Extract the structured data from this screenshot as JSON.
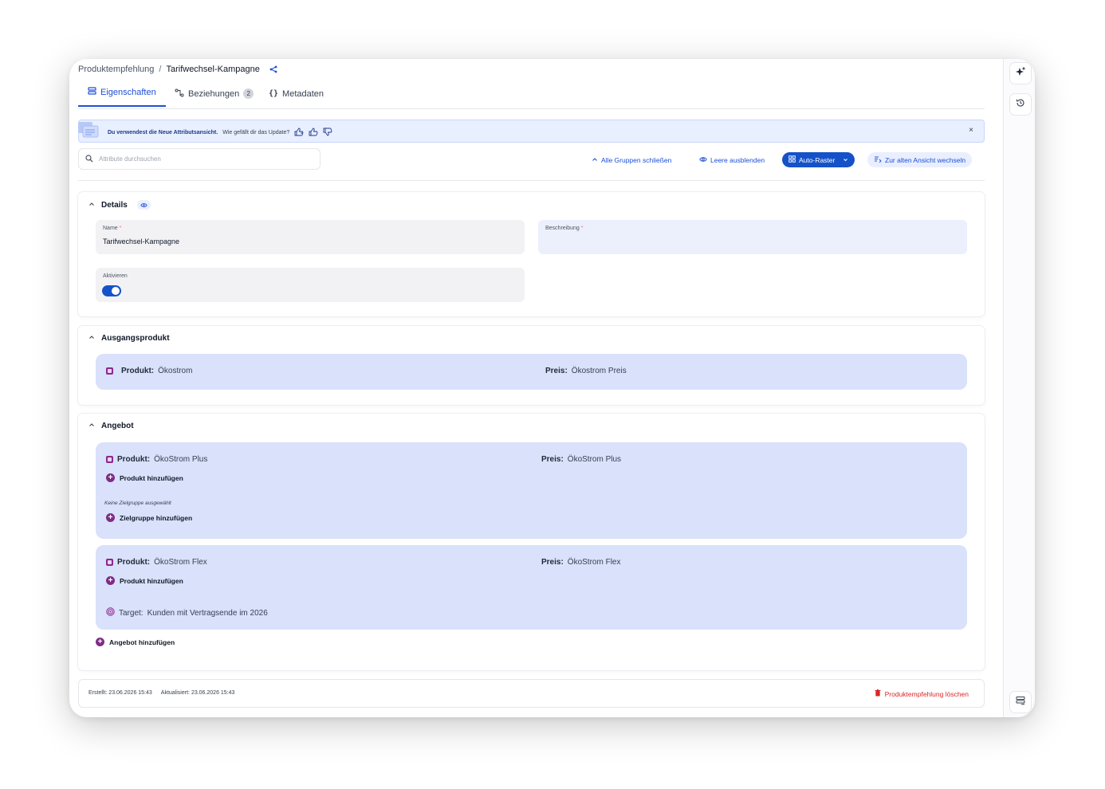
{
  "breadcrumb": {
    "parent": "Produktempfehlung",
    "separator": "/",
    "current": "Tarifwechsel-Kampagne"
  },
  "tabs": [
    {
      "label": "Eigenschaften"
    },
    {
      "label": "Beziehungen",
      "badge": "2"
    },
    {
      "label": "Metadaten"
    }
  ],
  "banner": {
    "message": "Du verwendest die Neue Attributsansicht.",
    "question": "Wie gefällt dir das Update?",
    "close": "×"
  },
  "search": {
    "placeholder": "Attribute durchsuchen"
  },
  "toolbar": {
    "collapse_all": "Alle Gruppen schließen",
    "hide_empty": "Leere ausblenden",
    "auto_grid": "Auto-Raster",
    "old_view": "Zur alten Ansicht wechseln"
  },
  "details": {
    "title": "Details",
    "name_label": "Name",
    "name_value": "Tarifwechsel-Kampagne",
    "description_label": "Beschreibung",
    "required_mark": "*",
    "activate_label": "Aktivieren",
    "activate_on": true
  },
  "source_product": {
    "title": "Ausgangsprodukt",
    "product_key": "Produkt:",
    "product_value": "Ökostrom",
    "price_key": "Preis:",
    "price_value": "Ökostrom Preis"
  },
  "offer": {
    "title": "Angebot",
    "items": [
      {
        "product_key": "Produkt:",
        "product_value": "ÖkoStrom Plus",
        "price_key": "Preis:",
        "price_value": "ÖkoStrom Plus",
        "add_product": "Produkt hinzufügen",
        "target_note": "Keine Zielgruppe ausgewählt",
        "add_target": "Zielgruppe hinzufügen"
      },
      {
        "product_key": "Produkt:",
        "product_value": "ÖkoStrom Flex",
        "price_key": "Preis:",
        "price_value": "ÖkoStrom Flex",
        "add_product": "Produkt hinzufügen",
        "target_key": "Target:",
        "target_value": "Kunden mit Vertragsende im 2026"
      }
    ],
    "add_offer": "Angebot hinzufügen"
  },
  "footer": {
    "created_label": "Erstellt:",
    "created_value": "23.06.2026 15:43",
    "updated_label": "Aktualisiert:",
    "updated_value": "23.06.2026 15:43",
    "delete": "Produktempfehlung löschen"
  },
  "colors": {
    "accent": "#1552c9",
    "card": "#d9e1fb",
    "danger": "#dc2626",
    "plum": "#7e2d86"
  },
  "icons": [
    "share-icon",
    "list-icon",
    "relations-icon",
    "braces-icon",
    "feedback-icon",
    "chevron-up-icon",
    "eye-icon",
    "grid-icon",
    "chevron-down-icon",
    "switch-view-icon",
    "search-icon",
    "sparkle-icon",
    "history-icon",
    "panel-icon",
    "trash-icon",
    "target-icon",
    "plus-icon",
    "product-icon"
  ]
}
